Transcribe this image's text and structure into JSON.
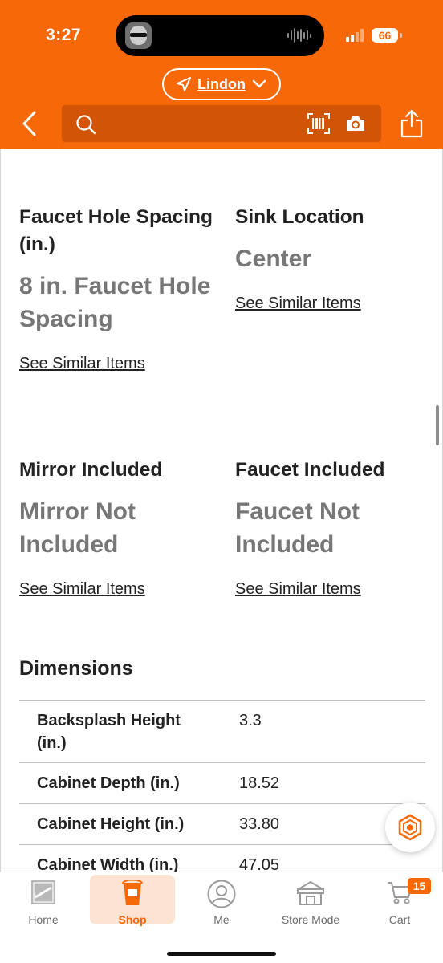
{
  "status_bar": {
    "time": "3:27",
    "battery": "66"
  },
  "header": {
    "location": "Lindon",
    "search_placeholder": "",
    "accent_color": "#f76808"
  },
  "specs": [
    {
      "label": "Faucet Hole Spacing (in.)",
      "value": "8 in. Faucet Hole Spacing",
      "link": "See Similar Items"
    },
    {
      "label": "Sink Location",
      "value": "Center",
      "link": "See Similar Items"
    },
    {
      "label": "Mirror Included",
      "value": "Mirror Not Included",
      "link": "See Similar Items"
    },
    {
      "label": "Faucet Included",
      "value": "Faucet Not Included",
      "link": "See Similar Items"
    }
  ],
  "dimensions": {
    "title": "Dimensions",
    "rows": [
      {
        "key": "Backsplash Height (in.)",
        "value": "3.3"
      },
      {
        "key": "Cabinet Depth (in.)",
        "value": "18.52"
      },
      {
        "key": "Cabinet Height (in.)",
        "value": "33.80"
      },
      {
        "key": "Cabinet Width (in.)",
        "value": "47.05"
      }
    ]
  },
  "bottom_nav": {
    "items": [
      {
        "label": "Home",
        "icon": "home-depot-logo-icon"
      },
      {
        "label": "Shop",
        "icon": "bucket-icon"
      },
      {
        "label": "Me",
        "icon": "user-icon"
      },
      {
        "label": "Store Mode",
        "icon": "store-icon"
      },
      {
        "label": "Cart",
        "icon": "cart-icon"
      }
    ],
    "active": "Shop",
    "cart_count": "15"
  }
}
